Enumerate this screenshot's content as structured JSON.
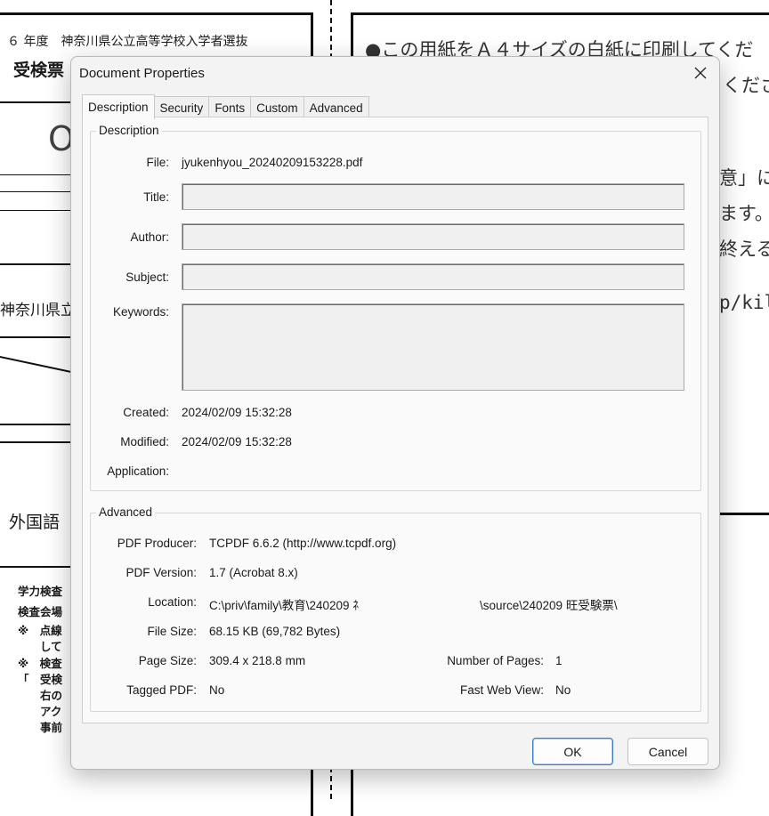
{
  "background": {
    "year_line": "６ 年度　神奈川県公立高等学校入学者選抜",
    "ticket": "受検票",
    "big_char": "O",
    "pref": "神奈川県立",
    "subject": "外国語",
    "notes": [
      "学力検査",
      "検査会場",
      "※　点線",
      "　　して",
      "※　検査",
      "「　受検",
      "　　右の",
      "　　アク",
      "　　事前"
    ],
    "right_lines": [
      "●この用紙をＡ４サイズの白紙に印刷してくだ",
      "くださ",
      "意」に",
      "ます。",
      "終える",
      "p/kil"
    ]
  },
  "dialog": {
    "title": "Document Properties",
    "tabs": [
      "Description",
      "Security",
      "Fonts",
      "Custom",
      "Advanced"
    ],
    "description": {
      "group_label": "Description",
      "file_label": "File:",
      "file_value": "jyukenhyou_20240209153228.pdf",
      "title_label": "Title:",
      "title_value": "",
      "author_label": "Author:",
      "author_value": "",
      "subject_label": "Subject:",
      "subject_value": "",
      "keywords_label": "Keywords:",
      "keywords_value": "",
      "created_label": "Created:",
      "created_value": "2024/02/09 15:32:28",
      "modified_label": "Modified:",
      "modified_value": "2024/02/09 15:32:28",
      "application_label": "Application:",
      "application_value": ""
    },
    "advanced": {
      "group_label": "Advanced",
      "producer_label": "PDF Producer:",
      "producer_value": "TCPDF 6.6.2 (http://www.tcpdf.org)",
      "version_label": "PDF Version:",
      "version_value": "1.7 (Acrobat 8.x)",
      "location_label": "Location:",
      "location_value_a": "C:\\priv\\family\\教育\\240209 ﾈ",
      "location_value_b": "\\source\\240209 旺受験票\\",
      "filesize_label": "File Size:",
      "filesize_value": "68.15 KB (69,782 Bytes)",
      "pagesize_label": "Page Size:",
      "pagesize_value": "309.4 x 218.8 mm",
      "pages_label": "Number of Pages:",
      "pages_value": "1",
      "tagged_label": "Tagged PDF:",
      "tagged_value": "No",
      "fastweb_label": "Fast Web View:",
      "fastweb_value": "No"
    },
    "ok_label": "OK",
    "cancel_label": "Cancel",
    "close_icon": "close-icon"
  }
}
